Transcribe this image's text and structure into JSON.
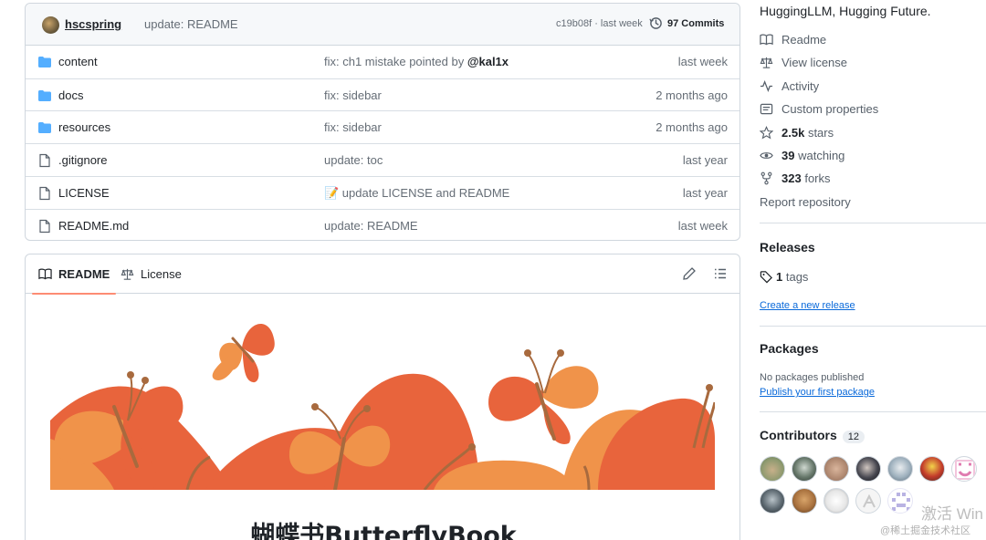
{
  "commit_bar": {
    "author": "hscspring",
    "message": "update: README",
    "meta": "c19b08f · last week",
    "commits": "97 Commits"
  },
  "files": [
    {
      "name": "content",
      "type": "folder",
      "message_prefix": "fix: ch1 mistake pointed by ",
      "message_bold": "@kal1x",
      "time": "last week"
    },
    {
      "name": "docs",
      "type": "folder",
      "message_prefix": "fix: sidebar",
      "message_bold": "",
      "time": "2 months ago"
    },
    {
      "name": "resources",
      "type": "folder",
      "message_prefix": "fix: sidebar",
      "message_bold": "",
      "time": "2 months ago"
    },
    {
      "name": ".gitignore",
      "type": "file",
      "message_prefix": "update: toc",
      "message_bold": "",
      "time": "last year"
    },
    {
      "name": "LICENSE",
      "type": "file",
      "message_prefix": "📝 update LICENSE and README",
      "message_bold": "",
      "time": "last year"
    },
    {
      "name": "README.md",
      "type": "file",
      "message_prefix": "update: README",
      "message_bold": "",
      "time": "last week"
    }
  ],
  "readme": {
    "tab_readme": "README",
    "tab_license": "License",
    "title": "蝴蝶书ButterflyBook"
  },
  "sidebar": {
    "about": "HuggingLLM, Hugging Future.",
    "readme": "Readme",
    "license": "View license",
    "activity": "Activity",
    "custom_properties": "Custom properties",
    "stars_count": "2.5k",
    "stars_label": "stars",
    "watching_count": "39",
    "watching_label": "watching",
    "forks_count": "323",
    "forks_label": "forks",
    "report": "Report repository",
    "releases_heading": "Releases",
    "tags_count": "1",
    "tags_label": "tags",
    "create_release": "Create a new release",
    "packages_heading": "Packages",
    "no_packages": "No packages published",
    "publish_package": "Publish your first package",
    "contributors_heading": "Contributors",
    "contributors_count": "12"
  },
  "watermark": {
    "activate": "激活 Win",
    "source": "@稀土掘金技术社区"
  },
  "colors": {
    "folder": "#54aeff",
    "accent_tab": "#fd8c73",
    "link": "#0969da",
    "butterfly_orange": "#e8643c",
    "butterfly_light": "#f0934a",
    "butterfly_body": "#a86a3e"
  }
}
